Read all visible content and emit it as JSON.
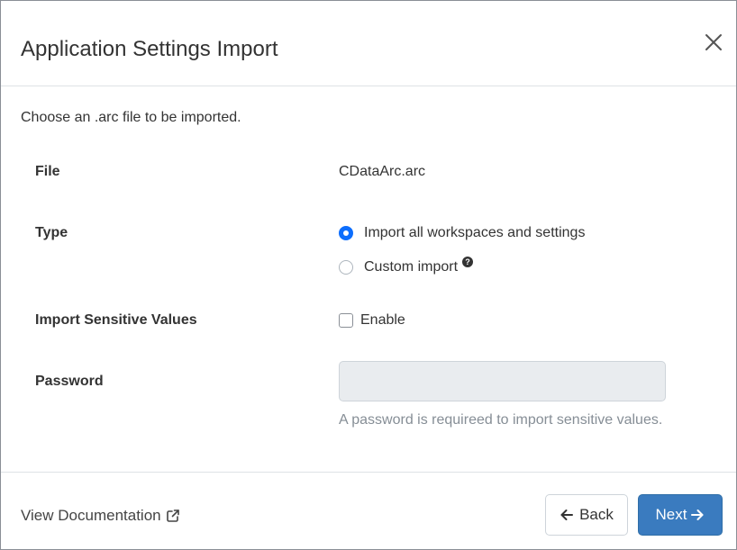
{
  "dialog": {
    "title": "Application Settings Import",
    "intro": "Choose an .arc file to be imported."
  },
  "fields": {
    "file": {
      "label": "File",
      "value": "CDataArc.arc"
    },
    "type": {
      "label": "Type",
      "options": [
        {
          "label": "Import all workspaces and settings",
          "checked": true
        },
        {
          "label": "Custom import",
          "checked": false
        }
      ],
      "help_icon_text": "?"
    },
    "sensitive": {
      "label": "Import Sensitive Values",
      "checkbox_label": "Enable",
      "checked": false
    },
    "password": {
      "label": "Password",
      "value": "",
      "hint": "A password is requireed to import sensitive values."
    }
  },
  "footer": {
    "doc_link": "View Documentation",
    "back_label": "Back",
    "next_label": "Next"
  },
  "icons": {
    "close": "close-icon",
    "external_link": "external-link-icon",
    "arrow_left": "arrow-left-icon",
    "arrow_right": "arrow-right-icon",
    "help": "question-circle-icon"
  },
  "colors": {
    "primary": "#3a7bbf",
    "radio_checked": "#0d6efd",
    "input_disabled_bg": "#e9ecef",
    "hint_text": "#868e96"
  }
}
